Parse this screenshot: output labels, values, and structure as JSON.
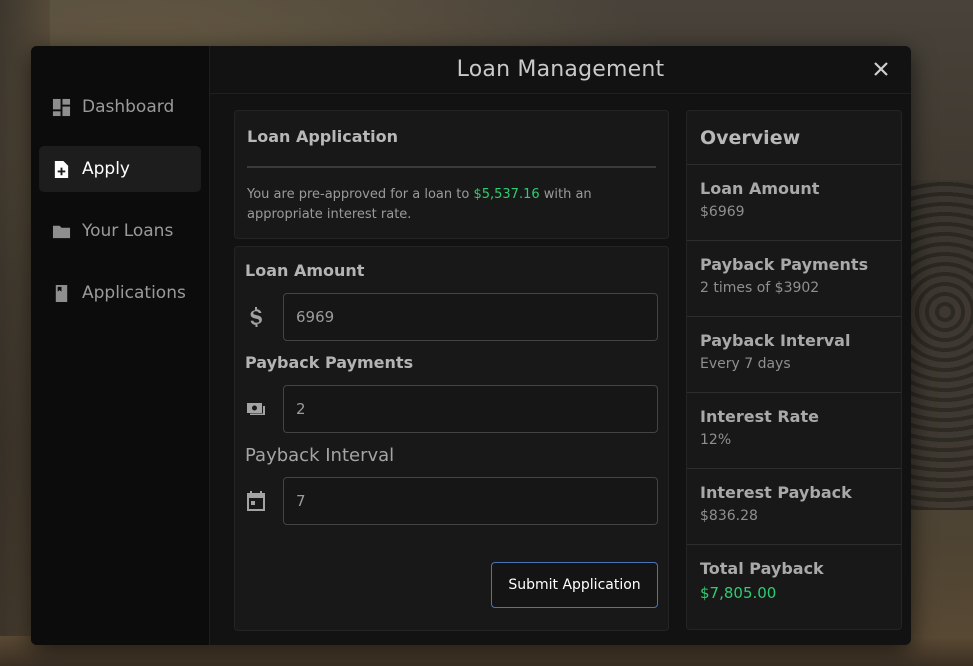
{
  "window": {
    "title": "Loan Management"
  },
  "sidebar": {
    "items": [
      {
        "label": "Dashboard",
        "icon": "dashboard-icon",
        "active": false
      },
      {
        "label": "Apply",
        "icon": "file-plus-icon",
        "active": true
      },
      {
        "label": "Your Loans",
        "icon": "folder-icon",
        "active": false
      },
      {
        "label": "Applications",
        "icon": "book-icon",
        "active": false
      }
    ]
  },
  "application": {
    "title": "Loan Application",
    "msg_prefix": "You are pre-approved for a loan to ",
    "preapproved_amount": "$5,537.16",
    "msg_suffix": " with an appropriate interest rate."
  },
  "form": {
    "amount": {
      "label": "Loan Amount",
      "value": "6969",
      "icon": "dollar-icon"
    },
    "payments": {
      "label": "Payback Payments",
      "value": "2",
      "icon": "money-icon"
    },
    "interval": {
      "label": "Payback Interval",
      "value": "7",
      "icon": "calendar-icon"
    },
    "submit_label": "Submit Application"
  },
  "overview": {
    "title": "Overview",
    "rows": [
      {
        "label": "Loan Amount",
        "value": "$6969"
      },
      {
        "label": "Payback Payments",
        "value": "2 times of $3902"
      },
      {
        "label": "Payback Interval",
        "value": "Every 7 days"
      },
      {
        "label": "Interest Rate",
        "value": "12%"
      },
      {
        "label": "Interest Payback",
        "value": "$836.28"
      },
      {
        "label": "Total Payback",
        "value": "$7,805.00"
      }
    ]
  },
  "colors": {
    "accent_green": "#2ecc71",
    "button_border": "#4b74b7"
  }
}
